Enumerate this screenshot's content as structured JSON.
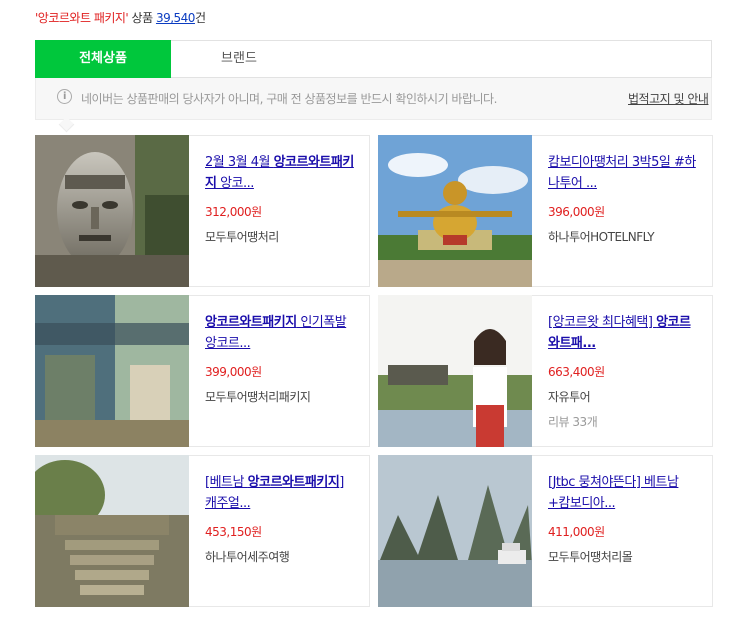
{
  "header": {
    "query": "'앙코르와트 패키지'",
    "label": " 상품 ",
    "count": "39,540",
    "unit": "건"
  },
  "tabs": {
    "all": "전체상품",
    "brand": "브랜드"
  },
  "notice": {
    "text": "네이버는 상품판매의 당사자가 아니며, 구매 전 상품정보를 반드시 확인하시기 바랍니다.",
    "link": "법적고지 및 안내"
  },
  "products": [
    {
      "title_pre": "2월 3월 4월 ",
      "title_bold": "앙코르와트패키지",
      "title_post": " 앙코...",
      "price": "312,000원",
      "seller": "모두투어땡처리",
      "image": "angkor-stone-face-photo"
    },
    {
      "title_pre": "캄보디아땡처리 3박5일 #하나투어 ...",
      "title_bold": "",
      "title_post": "",
      "price": "396,000원",
      "seller": "하나투어HOTELNFLY",
      "image": "golden-statue-photo"
    },
    {
      "title_pre": "",
      "title_bold": "앙코르와트패키지",
      "title_post": " 인기폭발 앙코르...",
      "price": "399,000원",
      "seller": "모두투어땡처리패키지",
      "image": "temple-gate-banner-photo"
    },
    {
      "title_pre": "[앙코르왓 최다혜택] ",
      "title_bold": "앙코르와트패...",
      "title_post": "",
      "price": "663,400원",
      "seller": "자유투어",
      "review_label": "리뷰",
      "review_count": "33개",
      "image": "woman-pointing-angkor-photo"
    },
    {
      "title_pre": "[베트남 ",
      "title_bold": "앙코르와트패키지",
      "title_post": "] 캐주얼...",
      "price": "453,150원",
      "seller": "하나투어세주여행",
      "image": "ruin-stairs-photo"
    },
    {
      "title_pre": "[Jtbc 뭉쳐야뜬다] 베트남+캄보디아...",
      "title_bold": "",
      "title_post": "",
      "price": "411,000원",
      "seller": "모두투어땡처리몰",
      "image": "halong-bay-photo"
    }
  ]
}
